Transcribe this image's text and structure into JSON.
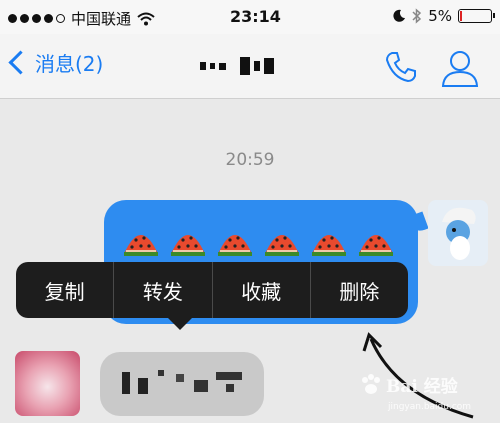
{
  "status_bar": {
    "carrier": "中国联通",
    "time": "23:14",
    "battery": "5%",
    "battery_level": 0.05
  },
  "nav": {
    "back_label": "消息(2)",
    "title": "",
    "accent_color": "#1a7cf2"
  },
  "chat": {
    "timestamp": "20:59",
    "outgoing_emoji_count": 6,
    "outgoing_emoji": "watermelon",
    "incoming_text": ""
  },
  "context_menu": {
    "items": [
      {
        "label": "复制"
      },
      {
        "label": "转发"
      },
      {
        "label": "收藏"
      },
      {
        "label": "删除"
      }
    ]
  },
  "watermark": {
    "logo_text": "Bai 经验",
    "sub_text": "jingyan.baidu.com"
  },
  "icons": {
    "phone": "phone-icon",
    "contact": "person-icon",
    "wifi": "wifi-icon",
    "moon": "moon-icon",
    "bluetooth": "bluetooth-icon"
  }
}
